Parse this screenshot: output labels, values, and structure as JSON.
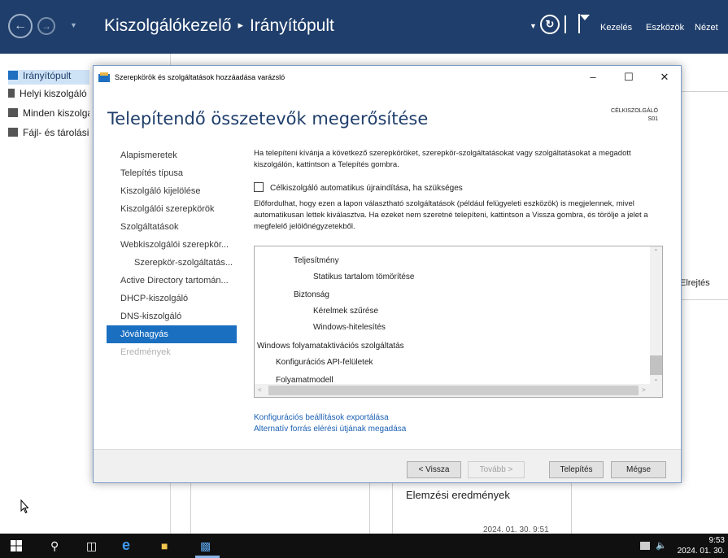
{
  "server_manager": {
    "title": "Kiszolgálókezelő",
    "breadcrumb_sep": "▸",
    "page": "Irányítópult",
    "menu": [
      "Kezelés",
      "Eszközök",
      "Nézet"
    ],
    "nav": [
      {
        "label": "Irányítópult",
        "selected": true
      },
      {
        "label": "Helyi kiszolgáló",
        "selected": false
      },
      {
        "label": "Minden kiszolgáló",
        "selected": false
      },
      {
        "label": "Fájl- és tárolási szolgáltatások",
        "selected": false
      }
    ],
    "tile_hide": "Elrejtés",
    "tile_results": "Elemzési eredmények",
    "tile_date": "2024. 01. 30. 9:51"
  },
  "wizard": {
    "title": "Szerepkörök és szolgáltatások hozzáadása varázsló",
    "heading": "Telepítendő összetevők megerősítése",
    "dest_label": "CÉLKISZOLGÁLÓ",
    "dest_server": "S01",
    "steps": [
      {
        "label": "Alapismeretek",
        "state": "normal"
      },
      {
        "label": "Telepítés típusa",
        "state": "normal"
      },
      {
        "label": "Kiszolgáló kijelölése",
        "state": "normal"
      },
      {
        "label": "Kiszolgálói szerepkörök",
        "state": "normal"
      },
      {
        "label": "Szolgáltatások",
        "state": "normal"
      },
      {
        "label": "Webkiszolgálói szerepkör...",
        "state": "normal"
      },
      {
        "label": "Szerepkör-szolgáltatás...",
        "state": "sub"
      },
      {
        "label": "Active Directory tartomán...",
        "state": "normal"
      },
      {
        "label": "DHCP-kiszolgáló",
        "state": "normal"
      },
      {
        "label": "DNS-kiszolgáló",
        "state": "normal"
      },
      {
        "label": "Jóváhagyás",
        "state": "current"
      },
      {
        "label": "Eredmények",
        "state": "disabled"
      }
    ],
    "intro": "Ha telepíteni kívánja a következő szerepköröket, szerepkör-szolgáltatásokat vagy szolgáltatásokat a megadott kiszolgálón, kattintson a Telepítés gombra.",
    "restart_checkbox": {
      "label": "Célkiszolgáló automatikus újraindítása, ha szükséges",
      "checked": false
    },
    "note": "Előfordulhat, hogy ezen a lapon választható szolgáltatások (például felügyeleti eszközök) is megjelennek, mivel automatikusan lettek kiválasztva. Ha ezeket nem szeretné telepíteni, kattintson a Vissza gombra, és törölje a jelet a megfelelő jelölőnégyzetekből.",
    "features": [
      {
        "label": "Teljesítmény",
        "level": 2
      },
      {
        "label": "Statikus tartalom tömörítése",
        "level": 3
      },
      {
        "label": "Biztonság",
        "level": 2
      },
      {
        "label": "Kérelmek szűrése",
        "level": 3
      },
      {
        "label": "Windows-hitelesítés",
        "level": 3
      },
      {
        "label": "Windows folyamataktivációs szolgáltatás",
        "level": 0
      },
      {
        "label": "Konfigurációs API-felületek",
        "level": 1
      },
      {
        "label": "Folyamatmodell",
        "level": 1
      }
    ],
    "links": {
      "export": "Konfigurációs beállítások exportálása",
      "alt_source": "Alternatív forrás elérési útjának megadása"
    },
    "buttons": {
      "back": "< Vissza",
      "next": "Tovább >",
      "install": "Telepítés",
      "cancel": "Mégse"
    }
  },
  "taskbar": {
    "time": "9:53",
    "date": "2024. 01. 30."
  }
}
